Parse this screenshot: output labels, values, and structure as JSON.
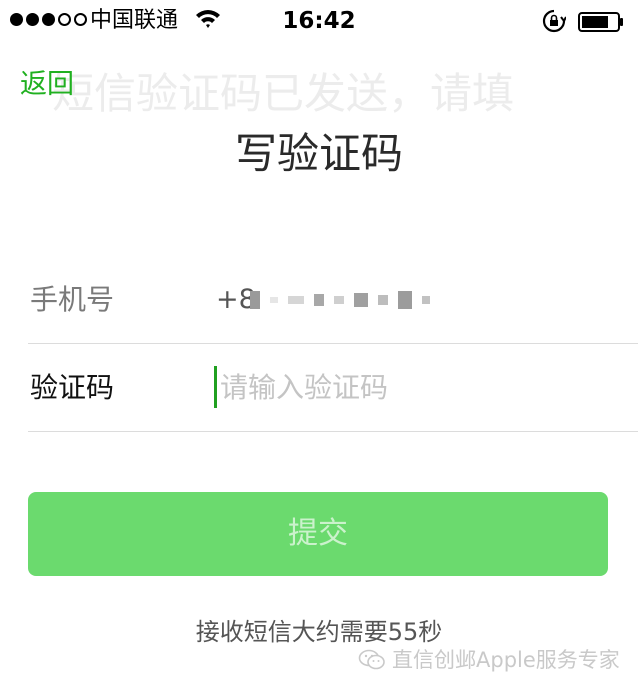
{
  "status_bar": {
    "signal_dots": [
      true,
      true,
      true,
      false,
      false
    ],
    "carrier": "中国联通",
    "time": "16:42"
  },
  "header": {
    "back_label": "返回",
    "title_line1": "短信验证码已发送，请填",
    "title_line2": "写验证码"
  },
  "form": {
    "phone_label": "手机号",
    "phone_prefix": "+8",
    "code_label": "验证码",
    "code_value": "",
    "code_placeholder": "请输入验证码"
  },
  "submit_label": "提交",
  "hint": "接收短信大约需要55秒",
  "watermark": "直信创邺Apple服务专家",
  "colors": {
    "accent": "#20b020",
    "button": "#6bda6e"
  },
  "icons": [
    "wifi-icon",
    "rotation-lock-icon",
    "battery-icon",
    "wechat-icon"
  ]
}
